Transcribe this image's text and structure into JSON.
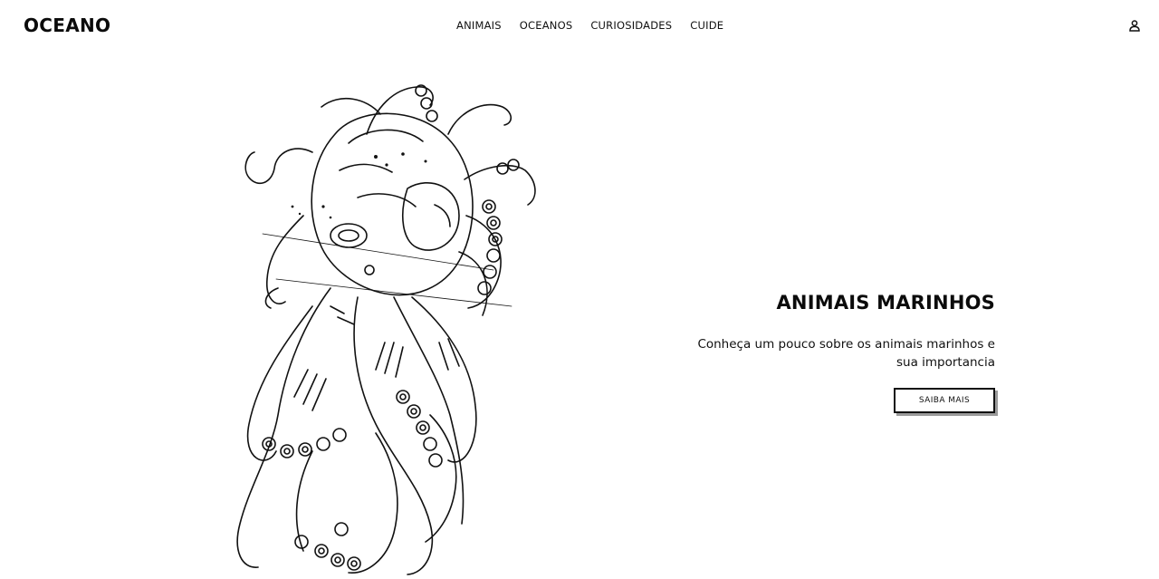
{
  "header": {
    "brand": "OCEANO",
    "nav": [
      {
        "label": "ANIMAIS"
      },
      {
        "label": "OCEANOS"
      },
      {
        "label": "CURIOSIDADES"
      },
      {
        "label": "CUIDE"
      }
    ],
    "user_icon": "user-icon"
  },
  "hero": {
    "illustration": "octopus-line-drawing",
    "title": "ANIMAIS MARINHOS",
    "description": "Conheça um pouco sobre os animais marinhos e sua importancia",
    "cta_label": "SAIBA MAIS"
  }
}
